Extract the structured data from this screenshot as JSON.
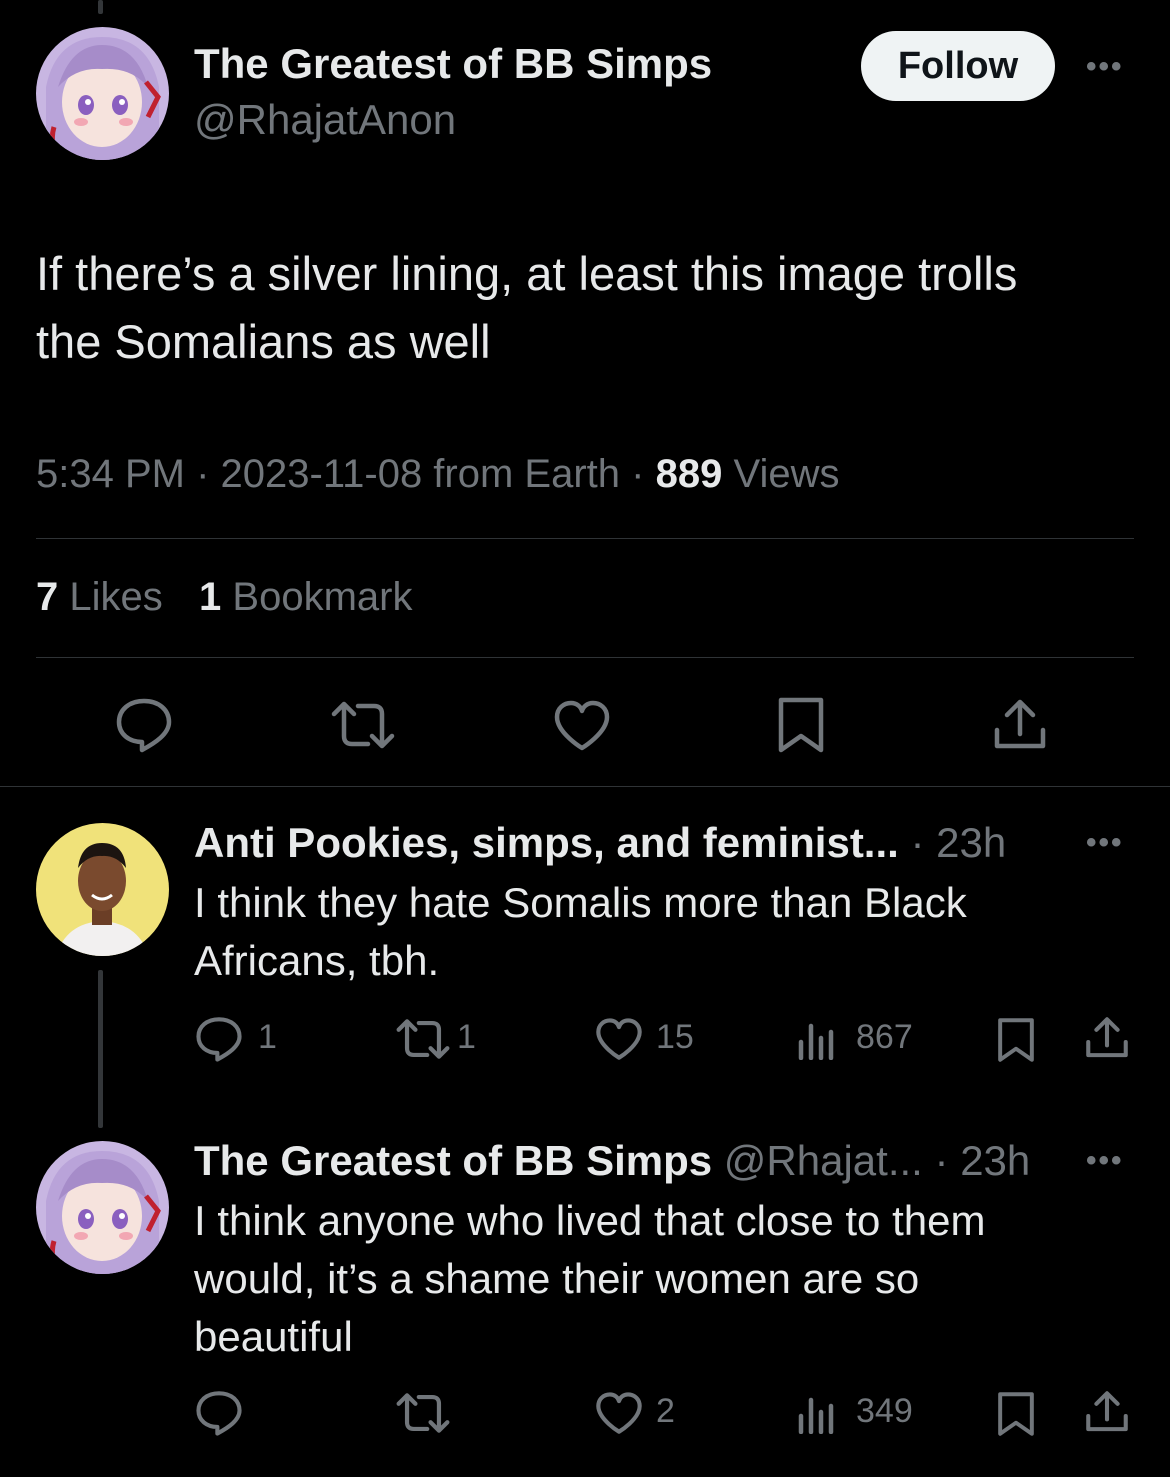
{
  "main_tweet": {
    "display_name": "The Greatest of BB Simps",
    "handle": "@RhajatAnon",
    "follow_label": "Follow",
    "text_line1": "If there’s a silver lining, at least this image trolls",
    "text_line2": "the Somalians as well",
    "time": "5:34 PM",
    "date": "2023-11-08 from Earth",
    "views_count": "889",
    "views_label": "Views",
    "likes_count": "7",
    "likes_label": "Likes",
    "bookmarks_count": "1",
    "bookmarks_label": "Bookmark"
  },
  "reply1": {
    "display_name": "Anti Pookies, simps, and feminist...",
    "time": "23h",
    "text_line1": "I think they hate Somalis more than Black",
    "text_line2": "Africans, tbh.",
    "replies": "1",
    "retweets": "1",
    "likes": "15",
    "views": "867"
  },
  "reply2": {
    "display_name": "The Greatest of BB Simps",
    "handle": "@Rhajat...",
    "time": "23h",
    "text_line1": "I think anyone who lived that close to them",
    "text_line2": "would, it’s a shame their women are so",
    "text_line3": "beautiful",
    "likes": "2",
    "views": "349"
  },
  "separator": "·",
  "more_label": "•••",
  "colors": {
    "background": "#000000",
    "text": "#e7e9ea",
    "secondary": "#71767b",
    "divider": "#2f3336",
    "follow_bg": "#eff3f4"
  },
  "icons": [
    "reply-icon",
    "retweet-icon",
    "like-icon",
    "bookmark-icon",
    "share-icon",
    "views-icon",
    "more-icon"
  ]
}
